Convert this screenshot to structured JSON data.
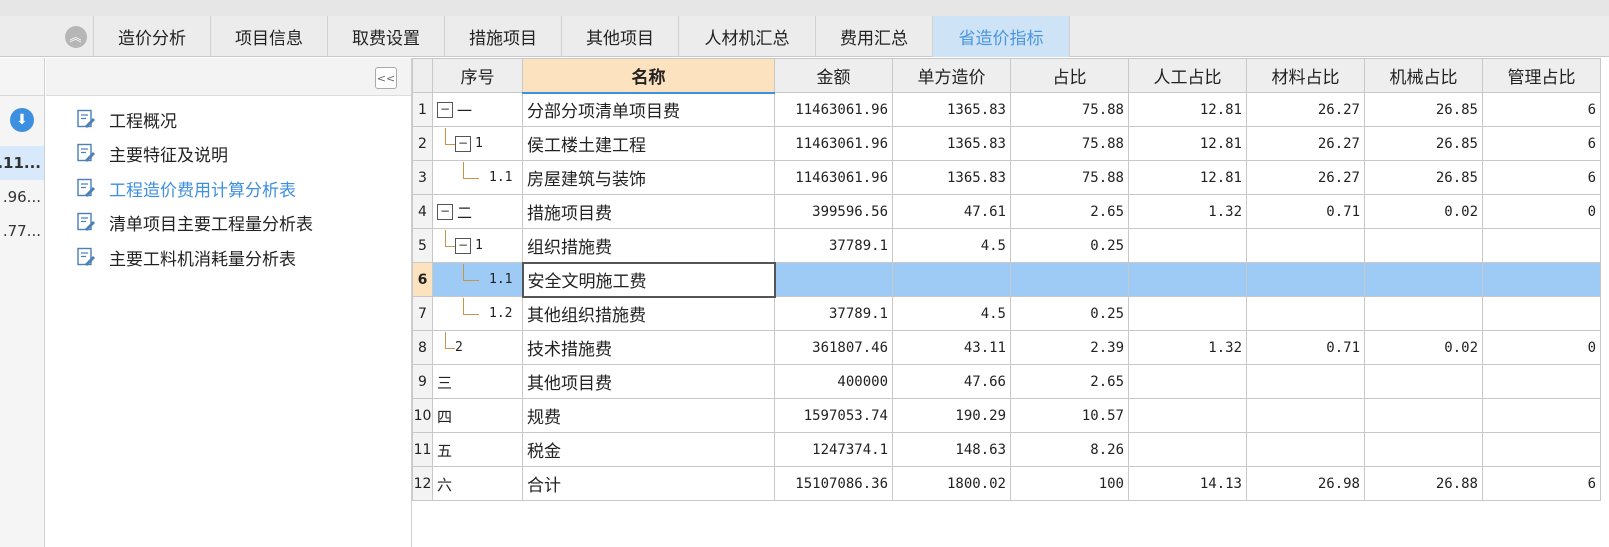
{
  "tabs": [
    {
      "label": "造价分析",
      "width": 117
    },
    {
      "label": "项目信息",
      "width": 117
    },
    {
      "label": "取费设置",
      "width": 117
    },
    {
      "label": "措施项目",
      "width": 117
    },
    {
      "label": "其他项目",
      "width": 117
    },
    {
      "label": "人材机汇总",
      "width": 137
    },
    {
      "label": "费用汇总",
      "width": 117
    },
    {
      "label": "省造价指标",
      "width": 137,
      "active": true
    }
  ],
  "left_pane": {
    "values": [
      ".11...",
      ".96...",
      ".77..."
    ]
  },
  "tree": {
    "items": [
      {
        "label": "工程概况",
        "link": false
      },
      {
        "label": "主要特征及说明",
        "link": false
      },
      {
        "label": "工程造价费用计算分析表",
        "link": true
      },
      {
        "label": "清单项目主要工程量分析表",
        "link": false
      },
      {
        "label": "主要工料机消耗量分析表",
        "link": false
      }
    ]
  },
  "grid": {
    "headers": [
      "序号",
      "名称",
      "金额",
      "单方造价",
      "占比",
      "人工占比",
      "材料占比",
      "机械占比",
      "管理占比"
    ],
    "rows": [
      {
        "row": "1",
        "seq": "一",
        "level": 0,
        "expand": true,
        "name": "分部分项清单项目费",
        "amount": "11463061.96",
        "unit": "1365.83",
        "ratio": "75.88",
        "labor": "12.81",
        "material": "26.27",
        "machine": "26.85",
        "mgmt": "6"
      },
      {
        "row": "2",
        "seq": "1",
        "level": 1,
        "expand": true,
        "name": "侯工楼土建工程",
        "amount": "11463061.96",
        "unit": "1365.83",
        "ratio": "75.88",
        "labor": "12.81",
        "material": "26.27",
        "machine": "26.85",
        "mgmt": "6"
      },
      {
        "row": "3",
        "seq": "1.1",
        "level": 2,
        "expand": false,
        "name": "房屋建筑与装饰",
        "amount": "11463061.96",
        "unit": "1365.83",
        "ratio": "75.88",
        "labor": "12.81",
        "material": "26.27",
        "machine": "26.85",
        "mgmt": "6"
      },
      {
        "row": "4",
        "seq": "二",
        "level": 0,
        "expand": true,
        "name": "措施项目费",
        "amount": "399596.56",
        "unit": "47.61",
        "ratio": "2.65",
        "labor": "1.32",
        "material": "0.71",
        "machine": "0.02",
        "mgmt": "0"
      },
      {
        "row": "5",
        "seq": "1",
        "level": 1,
        "expand": true,
        "name": "组织措施费",
        "amount": "37789.1",
        "unit": "4.5",
        "ratio": "0.25",
        "labor": "",
        "material": "",
        "machine": "",
        "mgmt": ""
      },
      {
        "row": "6",
        "seq": "1.1",
        "level": 2,
        "expand": false,
        "name": "安全文明施工费",
        "amount": "",
        "unit": "",
        "ratio": "",
        "labor": "",
        "material": "",
        "machine": "",
        "mgmt": "",
        "selected": true
      },
      {
        "row": "7",
        "seq": "1.2",
        "level": 2,
        "expand": false,
        "name": "其他组织措施费",
        "amount": "37789.1",
        "unit": "4.5",
        "ratio": "0.25",
        "labor": "",
        "material": "",
        "machine": "",
        "mgmt": ""
      },
      {
        "row": "8",
        "seq": "2",
        "level": 1,
        "expand": false,
        "name": "技术措施费",
        "amount": "361807.46",
        "unit": "43.11",
        "ratio": "2.39",
        "labor": "1.32",
        "material": "0.71",
        "machine": "0.02",
        "mgmt": "0"
      },
      {
        "row": "9",
        "seq": "三",
        "level": 0,
        "expand": false,
        "name": "其他项目费",
        "amount": "400000",
        "unit": "47.66",
        "ratio": "2.65",
        "labor": "",
        "material": "",
        "machine": "",
        "mgmt": ""
      },
      {
        "row": "10",
        "seq": "四",
        "level": 0,
        "expand": false,
        "name": "规费",
        "amount": "1597053.74",
        "unit": "190.29",
        "ratio": "10.57",
        "labor": "",
        "material": "",
        "machine": "",
        "mgmt": ""
      },
      {
        "row": "11",
        "seq": "五",
        "level": 0,
        "expand": false,
        "name": "税金",
        "amount": "1247374.1",
        "unit": "148.63",
        "ratio": "8.26",
        "labor": "",
        "material": "",
        "machine": "",
        "mgmt": ""
      },
      {
        "row": "12",
        "seq": "六",
        "level": 0,
        "expand": false,
        "name": "合计",
        "amount": "15107086.36",
        "unit": "1800.02",
        "ratio": "100",
        "labor": "14.13",
        "material": "26.98",
        "machine": "26.88",
        "mgmt": "6"
      }
    ]
  },
  "colors": {
    "accent": "#3d8fe0",
    "selected_row": "#9dcbf5",
    "header_highlight": "#fde2bf"
  }
}
